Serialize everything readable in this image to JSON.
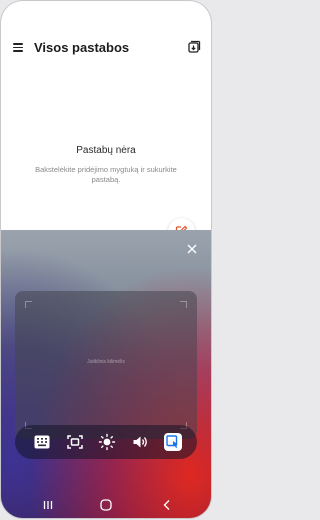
{
  "header": {
    "title": "Visos pastabos",
    "menu_icon": "menu-icon",
    "action_icon": "import-icon"
  },
  "empty_state": {
    "title": "Pastabų nėra",
    "subtitle": "Bakstelėkite pridėjimo mygtuką ir sukurkite pastabą."
  },
  "fab": {
    "icon": "compose-icon",
    "color": "#e2502c"
  },
  "panel": {
    "close_icon": "close-icon",
    "pad_label": "Jutiklinis kilimėlis",
    "toolbar": [
      {
        "name": "keyboard-icon",
        "active": false
      },
      {
        "name": "screen-capture-icon",
        "active": false
      },
      {
        "name": "brightness-icon",
        "active": false
      },
      {
        "name": "volume-icon",
        "active": false
      },
      {
        "name": "touchpad-icon",
        "active": true
      }
    ],
    "accent": "#1a73e8"
  },
  "navbar": {
    "recents_icon": "recents-icon",
    "home_icon": "home-icon",
    "back_icon": "back-icon"
  }
}
